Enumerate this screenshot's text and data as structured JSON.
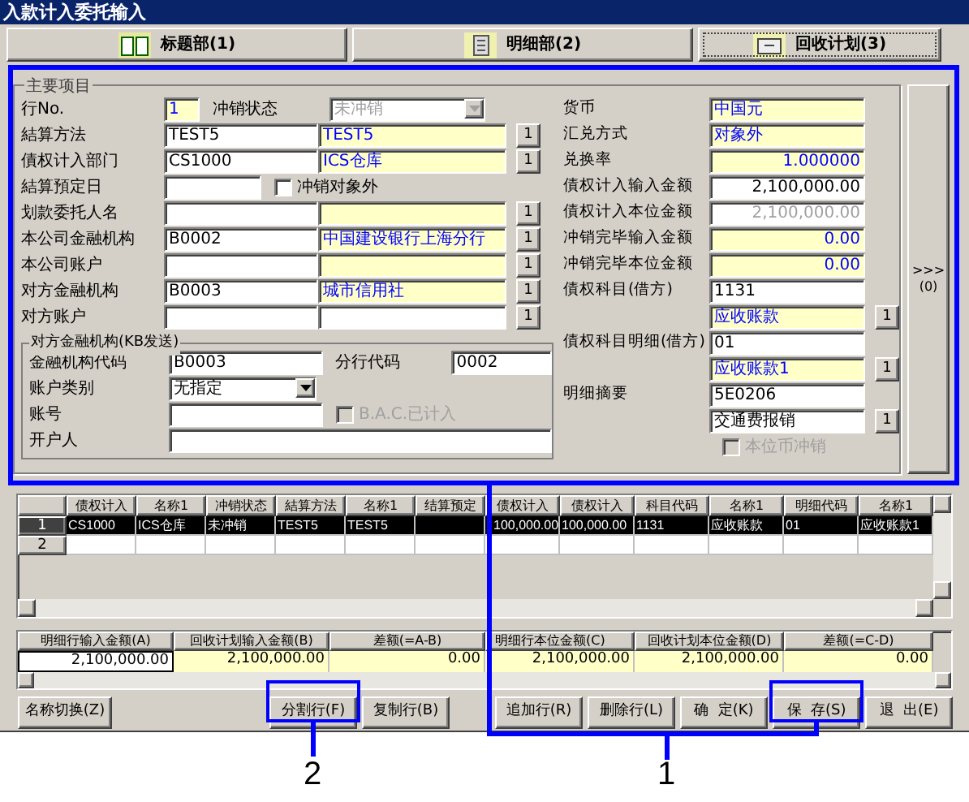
{
  "window": {
    "title": "入款计入委托输入"
  },
  "tabs": [
    {
      "label": "标题部(1)",
      "selected": false
    },
    {
      "label": "明细部(2)",
      "selected": false
    },
    {
      "label": "回收计划(3)",
      "selected": true
    }
  ],
  "main_group": {
    "title": "主要项目",
    "left_rows": [
      {
        "label": "行No.",
        "controls": [
          {
            "kind": "short",
            "value": "1",
            "readonly": true
          },
          {
            "kind": "label",
            "text": "冲销状态"
          },
          {
            "kind": "select",
            "value": "未冲销",
            "disabled": true
          }
        ]
      },
      {
        "label": "結算方法",
        "controls": [
          {
            "kind": "code",
            "value": "TEST5"
          },
          {
            "kind": "name",
            "value": "TEST5",
            "readonly": true
          },
          {
            "kind": "button",
            "text": "1"
          }
        ]
      },
      {
        "label": "債权计入部门",
        "controls": [
          {
            "kind": "code",
            "value": "CS1000"
          },
          {
            "kind": "name",
            "value": "ICS仓库",
            "readonly": true
          },
          {
            "kind": "button",
            "text": "1"
          }
        ]
      },
      {
        "label": "結算預定日",
        "controls": [
          {
            "kind": "date"
          },
          {
            "kind": "checkbox",
            "text": "冲销对象外",
            "checked": false,
            "disabled": false
          }
        ]
      },
      {
        "label": "划款委托人名",
        "controls": [
          {
            "kind": "code"
          },
          {
            "kind": "name",
            "readonly": true
          },
          {
            "kind": "button",
            "text": "1"
          }
        ]
      },
      {
        "label": "本公司金融机构",
        "controls": [
          {
            "kind": "code",
            "value": "B0002"
          },
          {
            "kind": "name",
            "value": "中国建设银行上海分行",
            "readonly": true
          },
          {
            "kind": "button",
            "text": "1"
          }
        ]
      },
      {
        "label": "本公司账户",
        "controls": [
          {
            "kind": "code"
          },
          {
            "kind": "name",
            "readonly": true
          },
          {
            "kind": "button",
            "text": "1"
          }
        ]
      },
      {
        "label": "对方金融机构",
        "controls": [
          {
            "kind": "code",
            "value": "B0003"
          },
          {
            "kind": "name",
            "value": "城市信用社",
            "readonly": true
          },
          {
            "kind": "button",
            "text": "1"
          }
        ]
      },
      {
        "label": "对方账户",
        "controls": [
          {
            "kind": "code"
          },
          {
            "kind": "name",
            "readonly": false
          },
          {
            "kind": "button",
            "text": "1"
          }
        ]
      }
    ],
    "sub_group": {
      "title": "对方金融机构(KB发送)",
      "rows": [
        {
          "label": "金融机构代码",
          "controls": [
            {
              "kind": "code",
              "value": "B0003"
            },
            {
              "kind": "label",
              "text": "分行代码"
            },
            {
              "kind": "branch",
              "value": "0002"
            }
          ]
        },
        {
          "label": "账户类别",
          "controls": [
            {
              "kind": "dropdown",
              "value": "无指定",
              "disabled": false
            }
          ]
        },
        {
          "label": "账号",
          "controls": [
            {
              "kind": "code"
            },
            {
              "kind": "checkbox",
              "text": "B.A.C.已计入",
              "checked": false,
              "disabled": true
            }
          ]
        },
        {
          "label": "开户人",
          "controls": [
            {
              "kind": "wide"
            }
          ]
        }
      ]
    },
    "right_rows": [
      {
        "label": "货币",
        "controls": [
          {
            "kind": "value",
            "value": "中国元",
            "readonly": true
          }
        ]
      },
      {
        "label": "汇兑方式",
        "controls": [
          {
            "kind": "value",
            "value": "对象外",
            "readonly": true
          }
        ]
      },
      {
        "label": "兑换率",
        "controls": [
          {
            "kind": "amount",
            "value": "1.000000",
            "readonly": true
          }
        ]
      },
      {
        "label": "債权计入输入金额",
        "controls": [
          {
            "kind": "amount",
            "value": "2,100,000.00",
            "readonly": false
          }
        ]
      },
      {
        "label": "債权计入本位金额",
        "controls": [
          {
            "kind": "amount",
            "value": "2,100,000.00",
            "disabled": true
          }
        ]
      },
      {
        "label": "冲销完毕输入金额",
        "controls": [
          {
            "kind": "amount",
            "value": "0.00",
            "readonly": true
          }
        ]
      },
      {
        "label": "冲销完毕本位金额",
        "controls": [
          {
            "kind": "amount",
            "value": "0.00",
            "readonly": true
          }
        ]
      },
      {
        "label": "債权科目(借方)",
        "controls": [
          {
            "kind": "value",
            "value": "1131"
          }
        ]
      },
      {
        "controls": [
          {
            "kind": "value",
            "value": "应收账款",
            "readonly": true
          },
          {
            "kind": "button",
            "text": "1"
          }
        ]
      },
      {
        "label": "債权科目明细(借方)",
        "controls": [
          {
            "kind": "value",
            "value": "01"
          }
        ]
      },
      {
        "controls": [
          {
            "kind": "value",
            "value": "应收账款1",
            "readonly": true
          },
          {
            "kind": "button",
            "text": "1"
          }
        ]
      },
      {
        "label": "明细摘要",
        "controls": [
          {
            "kind": "value",
            "value": "5E0206"
          }
        ]
      },
      {
        "controls": [
          {
            "kind": "value",
            "value": "交通费报销"
          },
          {
            "kind": "button",
            "text": "1"
          }
        ]
      },
      {
        "controls": [
          {
            "kind": "checkbox",
            "text": "本位币冲销",
            "checked": false,
            "disabled": true
          }
        ]
      }
    ]
  },
  "side_button": {
    "arrows": ">>>",
    "label": "(0)"
  },
  "table": {
    "columns": [
      "债权计入",
      "名称1",
      "冲销状态",
      "結算方法",
      "名称1",
      "结算预定",
      "债权计入",
      "债权计入",
      "科目代码",
      "名称1",
      "明细代码",
      "名称1"
    ],
    "rows": [
      {
        "number": "1",
        "selected": true,
        "cells": [
          "CS1000",
          "ICS仓库",
          "未冲销",
          "TEST5",
          "TEST5",
          "",
          "100,000.00",
          "100,000.00",
          "1131",
          "应收账款",
          "01",
          "应收账款1"
        ]
      },
      {
        "number": "2",
        "selected": false,
        "cells": [
          "",
          "",
          "",
          "",
          "",
          "",
          "",
          "",
          "",
          "",
          "",
          ""
        ]
      }
    ]
  },
  "summary": {
    "columns": [
      "明细行输入金额(A)",
      "回收计划输入金额(B)",
      "差额(=A-B)",
      "明细行本位金额(C)",
      "回收计划本位金额(D)",
      "差额(=C-D)"
    ],
    "values": [
      {
        "value": "2,100,000.00",
        "readonly": false
      },
      {
        "value": "2,100,000.00",
        "readonly": true
      },
      {
        "value": "0.00",
        "readonly": true
      },
      {
        "value": "2,100,000.00",
        "readonly": true
      },
      {
        "value": "2,100,000.00",
        "readonly": true
      },
      {
        "value": "0.00",
        "readonly": true
      }
    ]
  },
  "buttons": [
    {
      "label": "名称切换(Z)"
    },
    {
      "label": "分割行(F)"
    },
    {
      "label": "复制行(B)"
    },
    {
      "label": "追加行(R)"
    },
    {
      "label": "删除行(L)"
    },
    {
      "label": "确  定(K)"
    },
    {
      "label": "保  存(S)"
    },
    {
      "label": "退  出(E)"
    }
  ],
  "callouts": [
    {
      "label": "2"
    },
    {
      "label": "1"
    }
  ]
}
